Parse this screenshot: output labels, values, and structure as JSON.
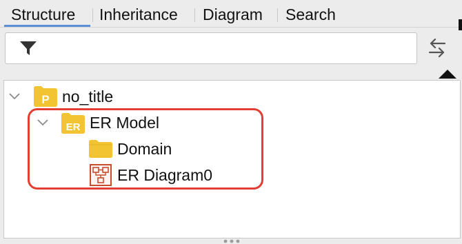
{
  "tabs": [
    {
      "label": "Structure",
      "active": true
    },
    {
      "label": "Inheritance",
      "active": false
    },
    {
      "label": "Diagram",
      "active": false
    },
    {
      "label": "Search",
      "active": false
    }
  ],
  "filter": {
    "value": "",
    "icon": "filter-icon"
  },
  "toolbar": {
    "sync_icon": "link-with-editor-icon",
    "collapse_icon": "triangle-up-icon"
  },
  "tree": {
    "project": {
      "label": "no_title",
      "icon": "project-folder-icon",
      "badge": "P",
      "expanded": true
    },
    "model": {
      "label": "ER Model",
      "icon": "er-model-folder-icon",
      "badge": "ER",
      "expanded": true
    },
    "domain": {
      "label": "Domain",
      "icon": "folder-icon"
    },
    "diagram": {
      "label": "ER Diagram0",
      "icon": "er-diagram-icon"
    }
  },
  "colors": {
    "folder": "#f3c431",
    "highlight": "#e23e33",
    "tab_underline": "#5b8fd6",
    "diagram_icon": "#c94b2e"
  }
}
